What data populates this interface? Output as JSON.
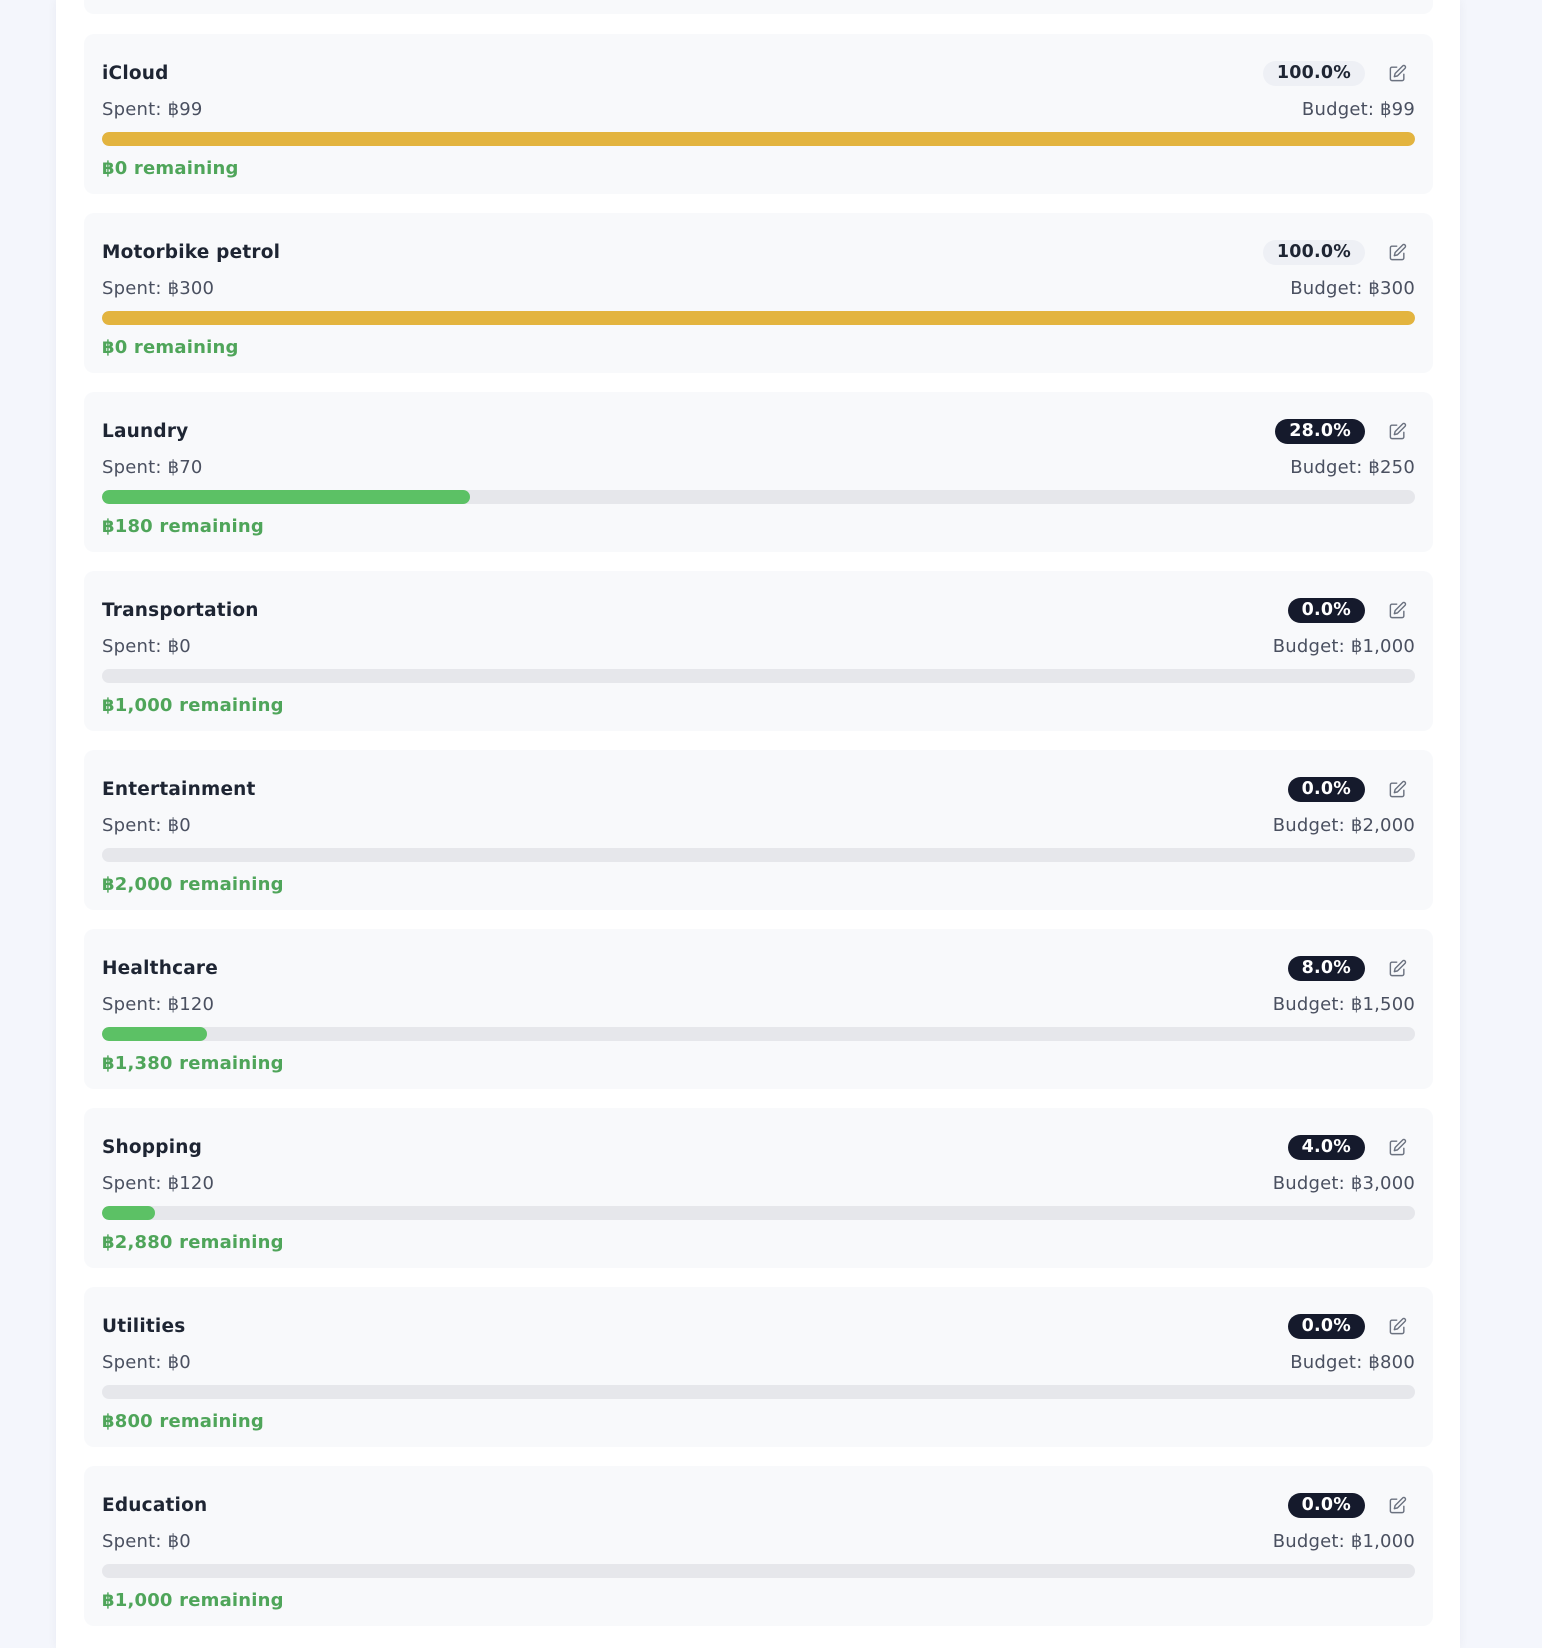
{
  "colors": {
    "fill_full": "#e3b43f",
    "fill_normal": "#5cc165",
    "remaining_text": "#4fa55a",
    "badge_dark_bg": "#151a2c",
    "badge_light_bg": "#eef0f5"
  },
  "budgets": [
    {
      "name": "iCloud",
      "percent": "100.0%",
      "progress": 1.0,
      "status": "full",
      "spent": "Spent: ฿99",
      "budget": "Budget: ฿99",
      "remaining": "฿0 remaining",
      "edit_icon": "edit-icon"
    },
    {
      "name": "Motorbike petrol",
      "percent": "100.0%",
      "progress": 1.0,
      "status": "full",
      "spent": "Spent: ฿300",
      "budget": "Budget: ฿300",
      "remaining": "฿0 remaining",
      "edit_icon": "edit-icon"
    },
    {
      "name": "Laundry",
      "percent": "28.0%",
      "progress": 0.28,
      "status": "normal",
      "spent": "Spent: ฿70",
      "budget": "Budget: ฿250",
      "remaining": "฿180 remaining",
      "edit_icon": "edit-icon"
    },
    {
      "name": "Transportation",
      "percent": "0.0%",
      "progress": 0.0,
      "status": "normal",
      "spent": "Spent: ฿0",
      "budget": "Budget: ฿1,000",
      "remaining": "฿1,000 remaining",
      "edit_icon": "edit-icon"
    },
    {
      "name": "Entertainment",
      "percent": "0.0%",
      "progress": 0.0,
      "status": "normal",
      "spent": "Spent: ฿0",
      "budget": "Budget: ฿2,000",
      "remaining": "฿2,000 remaining",
      "edit_icon": "edit-icon"
    },
    {
      "name": "Healthcare",
      "percent": "8.0%",
      "progress": 0.08,
      "status": "normal",
      "spent": "Spent: ฿120",
      "budget": "Budget: ฿1,500",
      "remaining": "฿1,380 remaining",
      "edit_icon": "edit-icon"
    },
    {
      "name": "Shopping",
      "percent": "4.0%",
      "progress": 0.04,
      "status": "normal",
      "spent": "Spent: ฿120",
      "budget": "Budget: ฿3,000",
      "remaining": "฿2,880 remaining",
      "edit_icon": "edit-icon"
    },
    {
      "name": "Utilities",
      "percent": "0.0%",
      "progress": 0.0,
      "status": "normal",
      "spent": "Spent: ฿0",
      "budget": "Budget: ฿800",
      "remaining": "฿800 remaining",
      "edit_icon": "edit-icon"
    },
    {
      "name": "Education",
      "percent": "0.0%",
      "progress": 0.0,
      "status": "normal",
      "spent": "Spent: ฿0",
      "budget": "Budget: ฿1,000",
      "remaining": "฿1,000 remaining",
      "edit_icon": "edit-icon"
    }
  ]
}
